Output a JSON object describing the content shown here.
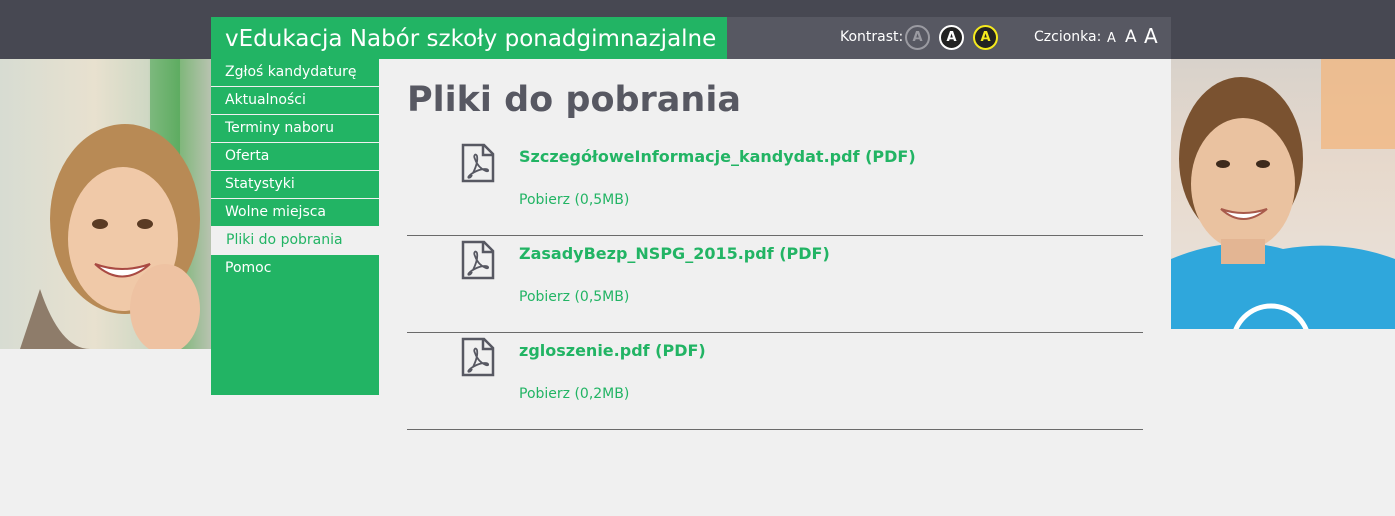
{
  "header": {
    "brand": "vEdukacja Nabór szkoły ponadgimnazjalne",
    "kontrast_label": "Kontrast:",
    "contrast_options": [
      "A",
      "A",
      "A"
    ],
    "czcionka_label": "Czcionka:",
    "font_sizes": [
      "A",
      "A",
      "A"
    ]
  },
  "sidebar": {
    "items": [
      {
        "label": "Zgłoś kandydaturę"
      },
      {
        "label": "Aktualności"
      },
      {
        "label": "Terminy naboru"
      },
      {
        "label": "Oferta"
      },
      {
        "label": "Statystyki"
      },
      {
        "label": "Wolne miejsca"
      },
      {
        "label": "Pliki do pobrania"
      },
      {
        "label": "Pomoc"
      }
    ],
    "active_index": 6
  },
  "main": {
    "title": "Pliki do pobrania",
    "files": [
      {
        "name": "SzczegółoweInformacje_kandydat.pdf (PDF)",
        "download": "Pobierz (0,5MB)",
        "icon": "pdf-file-icon"
      },
      {
        "name": "ZasadyBezp_NSPG_2015.pdf (PDF)",
        "download": "Pobierz (0,5MB)",
        "icon": "pdf-file-icon"
      },
      {
        "name": "zgloszenie.pdf (PDF)",
        "download": "Pobierz (0,2MB)",
        "icon": "pdf-file-icon"
      }
    ]
  },
  "colors": {
    "accent": "#22b464",
    "topbar": "#474852",
    "access_bar": "#575862",
    "background": "#f0f0f0"
  }
}
